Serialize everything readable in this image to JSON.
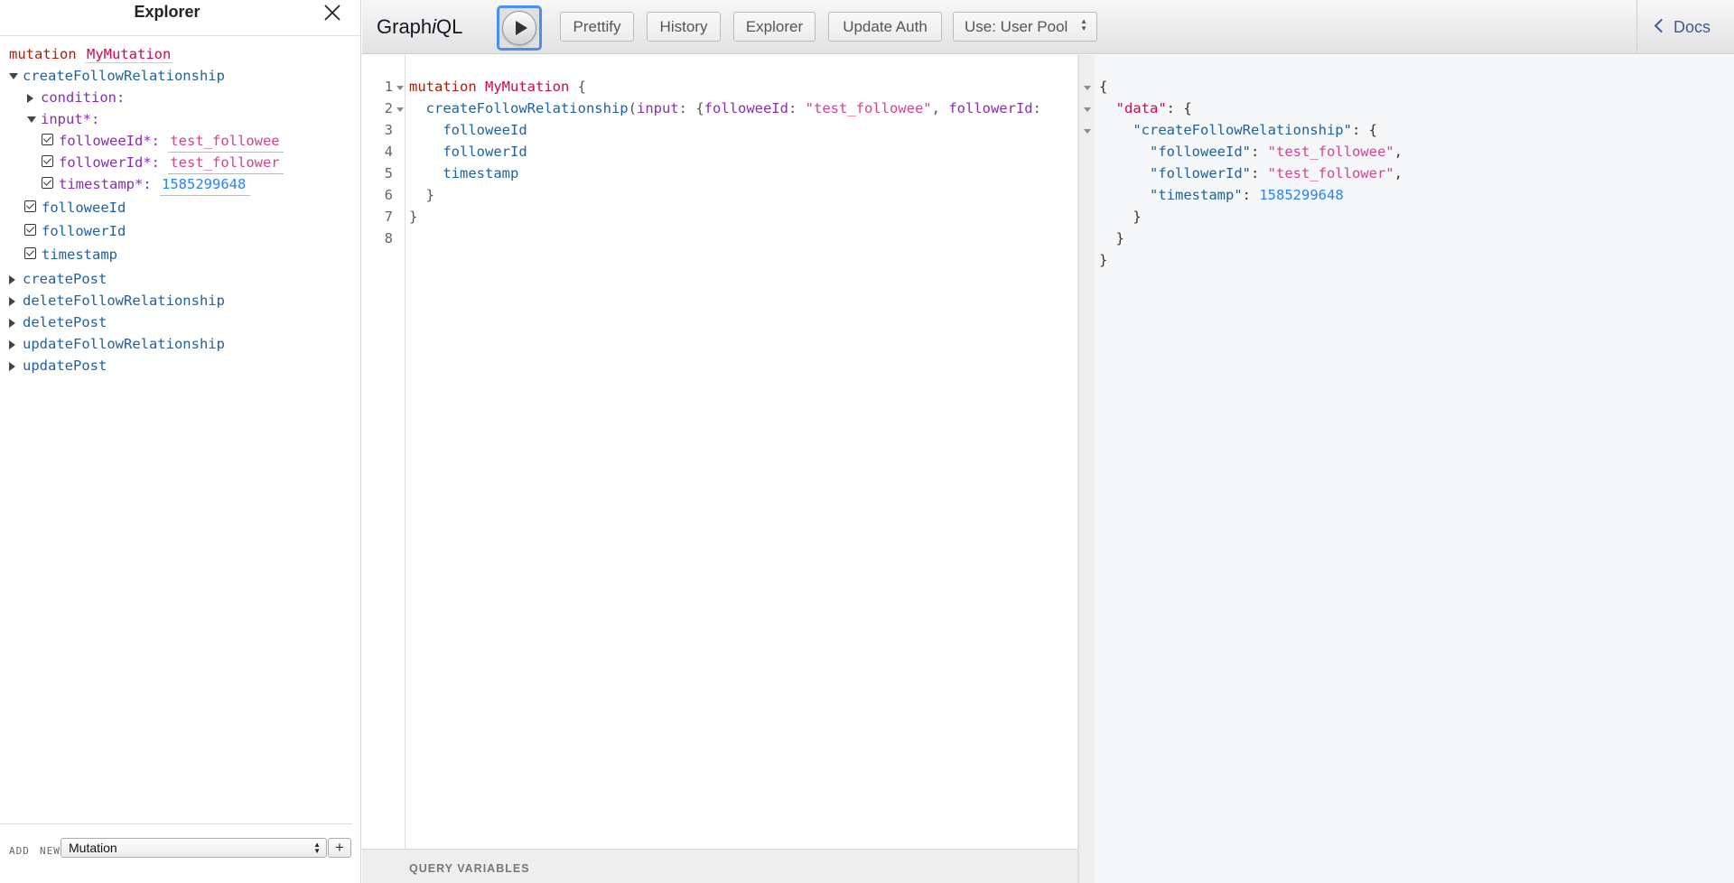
{
  "explorer": {
    "title": "Explorer",
    "operation_keyword": "mutation",
    "operation_name": "MyMutation",
    "root_field": "createFollowRelationship",
    "args": {
      "condition": "condition:",
      "input": "input*:"
    },
    "input_fields": [
      {
        "label": "followeeId*:",
        "value": "test_followee",
        "kind": "string"
      },
      {
        "label": "followerId*:",
        "value": "test_follower",
        "kind": "string"
      },
      {
        "label": "timestamp*:",
        "value": "1585299648",
        "kind": "number"
      }
    ],
    "selected_fields": [
      "followeeId",
      "followerId",
      "timestamp"
    ],
    "other_fields": [
      "createPost",
      "deleteFollowRelationship",
      "deletePost",
      "updateFollowRelationship",
      "updatePost"
    ],
    "footer": {
      "add_label": "ADD",
      "new_label": "NEW",
      "operation_type": "Mutation",
      "add_button": "+"
    }
  },
  "toolbar": {
    "title_pre": "Graph",
    "title_i": "i",
    "title_post": "QL",
    "buttons": [
      "Prettify",
      "History",
      "Explorer",
      "Update Auth",
      "Use: User Pool"
    ],
    "docs_label": "Docs"
  },
  "editor": {
    "line_numbers": [
      "1",
      "2",
      "3",
      "4",
      "5",
      "6",
      "7",
      "8"
    ],
    "query_variables_label": "QUERY VARIABLES",
    "code": {
      "l1_kw": "mutation",
      "l1_name": "MyMutation",
      "l1_brace": " {",
      "l2_field": "createFollowRelationship",
      "l2_paren": "(",
      "l2_arg": "input",
      "l2_colon": ": {",
      "l2_k1": "followeeId",
      "l2_c1": ": ",
      "l2_v1": "\"test_followee\"",
      "l2_comma": ", ",
      "l2_k2": "followerId",
      "l2_c2": ":",
      "l3": "followeeId",
      "l4": "followerId",
      "l5": "timestamp",
      "l6": "}",
      "l7": "}"
    }
  },
  "result": {
    "open": "{",
    "data_key": "\"data\"",
    "data_open": ": {",
    "cfr_key": "\"createFollowRelationship\"",
    "cfr_open": ": {",
    "k1": "\"followeeId\"",
    "v1": "\"test_followee\"",
    "k2": "\"followerId\"",
    "v2": "\"test_follower\"",
    "k3": "\"timestamp\"",
    "v3": "1585299648",
    "close1": "}",
    "close2": "}",
    "close3": "}"
  }
}
